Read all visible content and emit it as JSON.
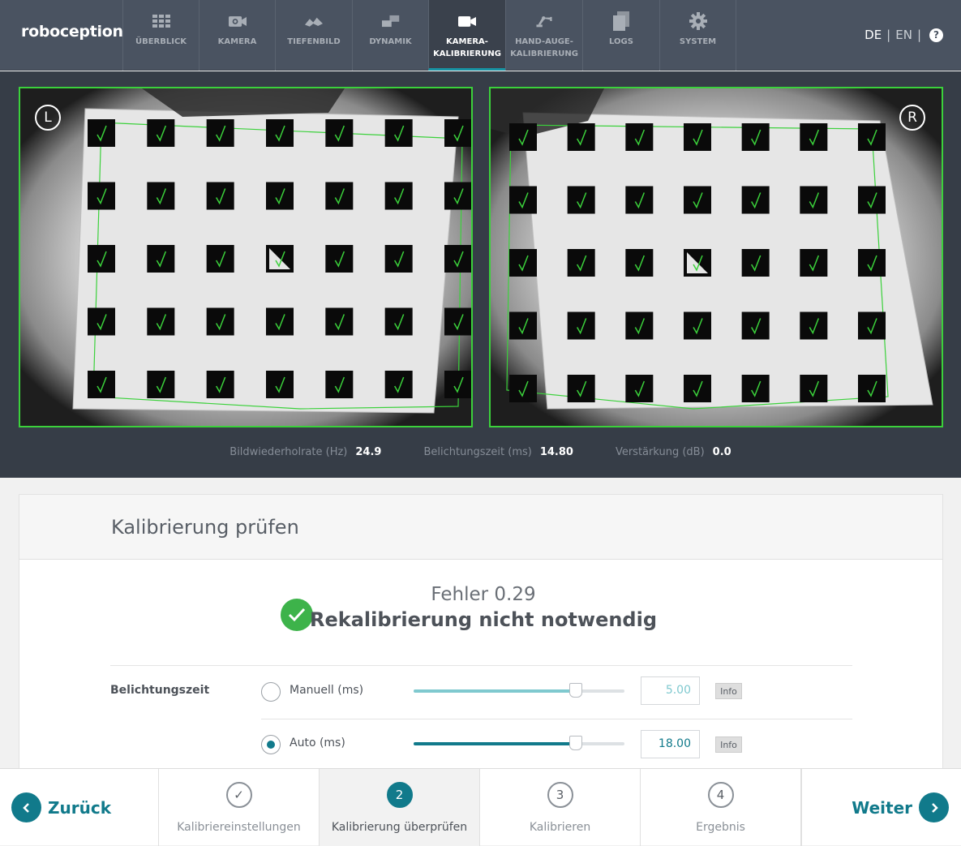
{
  "app": {
    "logo": "roboception"
  },
  "nav": {
    "items": [
      {
        "label": "ÜBERBLICK",
        "icon": "grid-icon"
      },
      {
        "label": "KAMERA",
        "icon": "camera-icon"
      },
      {
        "label": "TIEFENBILD",
        "icon": "depth-icon"
      },
      {
        "label": "DYNAMIK",
        "icon": "dynamics-icon"
      },
      {
        "label": "KAMERA-\nKALIBRIERUNG",
        "icon": "video-camera-icon",
        "active": true
      },
      {
        "label": "HAND-AUGE-\nKALIBRIERUNG",
        "icon": "robot-arm-icon"
      },
      {
        "label": "LOGS",
        "icon": "documents-icon"
      },
      {
        "label": "SYSTEM",
        "icon": "gear-icon"
      }
    ],
    "lang_de": "DE",
    "lang_sep": "|",
    "lang_en": "EN",
    "help": "?"
  },
  "cameras": {
    "left_label": "L",
    "right_label": "R"
  },
  "stats": {
    "framerate_label": "Bildwiederholrate (Hz)",
    "framerate_value": "24.9",
    "exposure_label": "Belichtungszeit (ms)",
    "exposure_value": "14.80",
    "gain_label": "Verstärkung (dB)",
    "gain_value": "0.0"
  },
  "card": {
    "title": "Kalibrierung prüfen",
    "error_text": "Fehler 0.29",
    "result_text": "Rekalibrierung nicht notwendig",
    "exposure_label": "Belichtungszeit",
    "manual_label": "Manuell (ms)",
    "manual_value": "5.00",
    "manual_level": 0.77,
    "auto_label": "Auto (ms)",
    "auto_value": "18.00",
    "auto_level": 0.77,
    "selected_mode": "auto",
    "info_label": "Info",
    "accent_color": "#117a8b",
    "ok_color": "#3db34a"
  },
  "wizard": {
    "back_label": "Zurück",
    "next_label": "Weiter",
    "steps": [
      {
        "number": "✓",
        "label": "Kalibriereinstellungen"
      },
      {
        "number": "2",
        "label": "Kalibrierung überprüfen"
      },
      {
        "number": "3",
        "label": "Kalibrieren"
      },
      {
        "number": "4",
        "label": "Ergebnis"
      }
    ]
  }
}
